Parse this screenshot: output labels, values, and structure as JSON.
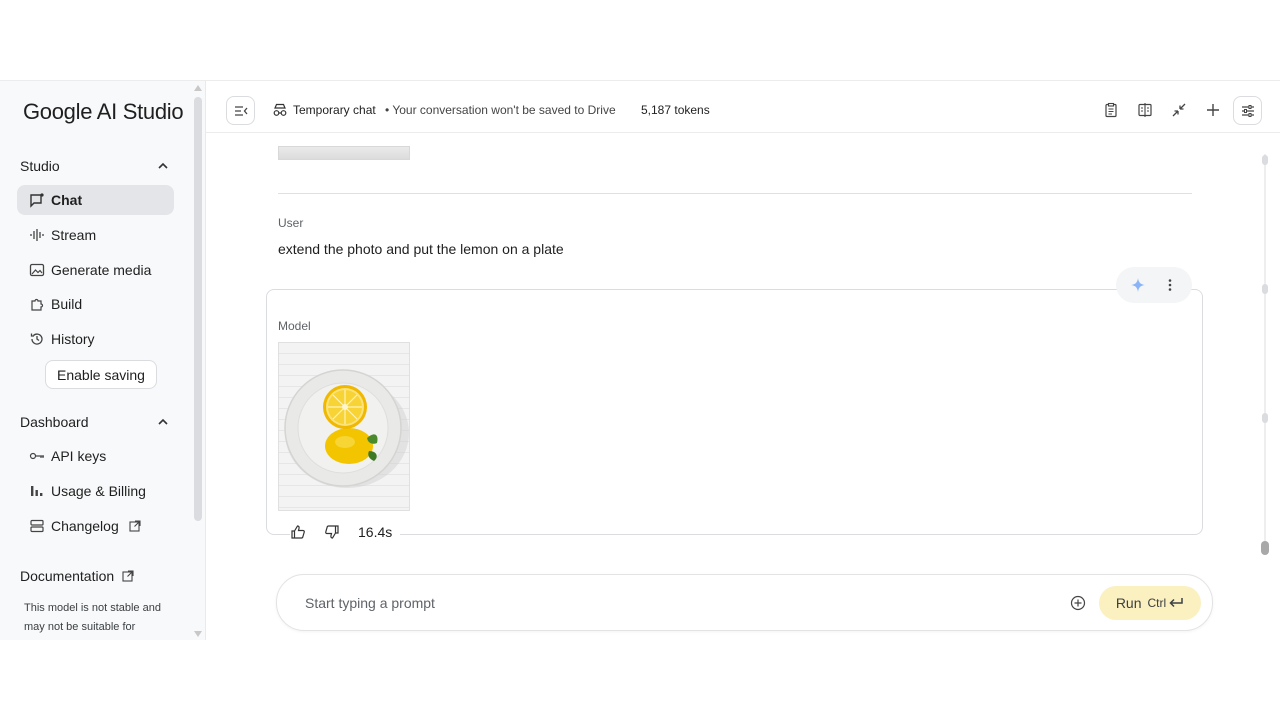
{
  "sidebar": {
    "logo": "Google AI Studio",
    "studio_section": "Studio",
    "items": [
      {
        "label": "Chat",
        "icon": "chat-icon"
      },
      {
        "label": "Stream",
        "icon": "stream-icon"
      },
      {
        "label": "Generate media",
        "icon": "generate-media-icon"
      },
      {
        "label": "Build",
        "icon": "build-icon"
      },
      {
        "label": "History",
        "icon": "history-icon"
      }
    ],
    "enable_saving": "Enable saving",
    "dashboard_section": "Dashboard",
    "dashboard_items": [
      {
        "label": "API keys",
        "icon": "key-icon"
      },
      {
        "label": "Usage & Billing",
        "icon": "bar-chart-icon"
      },
      {
        "label": "Changelog",
        "icon": "changelog-icon"
      }
    ],
    "documentation": "Documentation",
    "note": "This model is not stable and may not be suitable for"
  },
  "topbar": {
    "title": "Temporary chat",
    "subtitle": "• Your conversation won't be saved to Drive",
    "tokens": "5,187 tokens"
  },
  "chat": {
    "user_label": "User",
    "user_message": "extend the photo and put the lemon on a plate",
    "model_label": "Model",
    "response_time": "16.4s"
  },
  "prompt": {
    "placeholder": "Start typing a prompt",
    "run_label": "Run",
    "run_shortcut": "Ctrl"
  },
  "colors": {
    "run_button_bg": "#fbf0c0",
    "active_nav_bg": "#e3e5e8",
    "sparkle": "#8ab4f8"
  }
}
